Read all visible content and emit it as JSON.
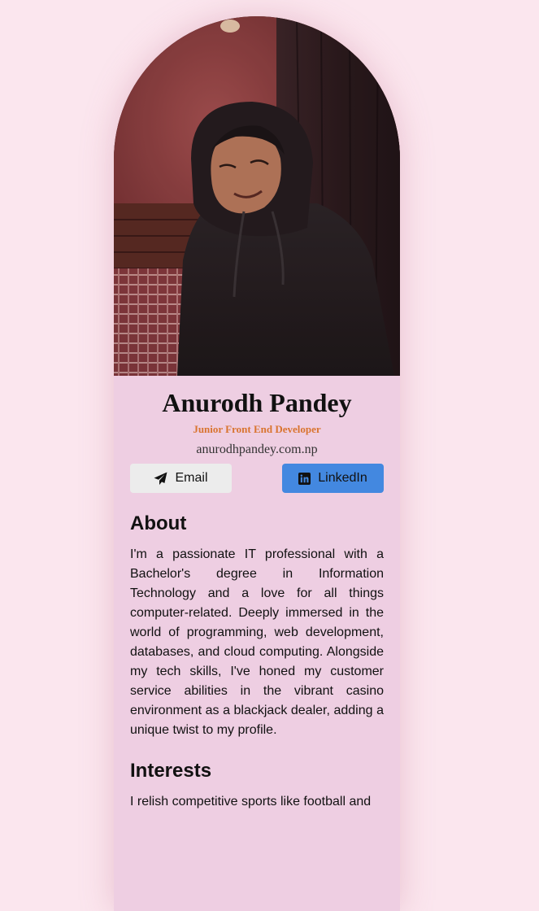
{
  "profile": {
    "name": "Anurodh Pandey",
    "role": "Junior Front End Developer",
    "website": "anurodhpandey.com.np",
    "photo_alt": "profile-photo"
  },
  "buttons": {
    "email_label": "Email",
    "linkedin_label": "LinkedIn"
  },
  "about": {
    "heading": "About",
    "text": "I'm a passionate IT professional with a Bachelor's degree in Information Technology and a love for all things computer-related. Deeply immersed in the world of programming, web development, databases, and cloud computing. Alongside my tech skills, I've honed my customer service abilities in the vibrant casino environment as a blackjack dealer, adding a unique twist to my profile."
  },
  "interests": {
    "heading": "Interests",
    "text": "I relish competitive sports like football and"
  },
  "colors": {
    "page_bg": "#fbe6ee",
    "card_bg": "#eecee2",
    "role_accent": "#d9742f",
    "linkedin_button": "#4388e0",
    "email_button": "#ececec"
  },
  "icons": {
    "email": "paper-plane-icon",
    "linkedin": "linkedin-icon"
  }
}
